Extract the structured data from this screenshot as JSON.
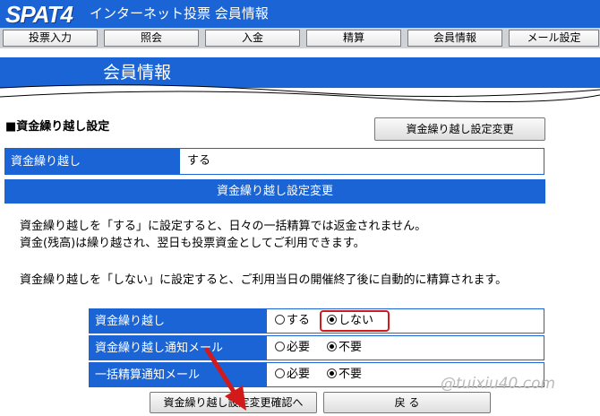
{
  "header": {
    "logo": "SPAT4",
    "title": "インターネット投票 会員情報"
  },
  "nav": [
    {
      "label": "投票入力"
    },
    {
      "label": "照会"
    },
    {
      "label": "入金"
    },
    {
      "label": "精算"
    },
    {
      "label": "会員情報"
    },
    {
      "label": "メール設定"
    }
  ],
  "page_title": "会員情報",
  "section": {
    "title": "■資金繰り越し設定",
    "change_button": "資金繰り越し設定変更",
    "current_label": "資金繰り越し",
    "current_value": "する",
    "form_heading": "資金繰り越し設定変更"
  },
  "description": {
    "line1": "資金繰り越しを「する」に設定すると、日々の一括精算では返金されません。",
    "line2": "資金(残高)は繰り越され、翌日も投票資金としてご利用できます。",
    "line3": "資金繰り越しを「しない」に設定すると、ご利用当日の開催終了後に自動的に精算されます。"
  },
  "form": {
    "rows": [
      {
        "label": "資金繰り越し",
        "options": [
          "する",
          "しない"
        ],
        "selected": "しない"
      },
      {
        "label": "資金繰り越し通知メール",
        "options": [
          "必要",
          "不要"
        ],
        "selected": "不要"
      },
      {
        "label": "一括精算通知メール",
        "options": [
          "必要",
          "不要"
        ],
        "selected": "不要"
      }
    ]
  },
  "buttons": {
    "confirm": "資金繰り越し設定変更確認へ",
    "back": "戻 る"
  },
  "watermark": "@tuixiu40.com",
  "colors": {
    "brand_blue": "#1a64d6",
    "highlight_red": "#d21a1a"
  }
}
